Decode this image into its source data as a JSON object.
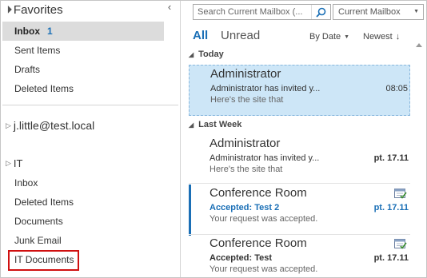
{
  "favorites": {
    "header": "Favorites",
    "items": [
      {
        "label": "Inbox",
        "count": "1"
      },
      {
        "label": "Sent Items"
      },
      {
        "label": "Drafts"
      },
      {
        "label": "Deleted Items"
      }
    ]
  },
  "accounts": [
    {
      "label": "j.little@test.local"
    }
  ],
  "it_group": {
    "header": "IT",
    "items": [
      {
        "label": "Inbox"
      },
      {
        "label": "Deleted Items"
      },
      {
        "label": "Documents"
      },
      {
        "label": "Junk Email"
      },
      {
        "label": "IT Documents"
      }
    ]
  },
  "search": {
    "placeholder": "Search Current Mailbox (...",
    "scope": "Current Mailbox"
  },
  "list_header": {
    "tab_all": "All",
    "tab_unread": "Unread",
    "sort_by": "By Date",
    "sort_order": "Newest"
  },
  "groups": [
    {
      "label": "Today",
      "messages": [
        {
          "sender": "Administrator",
          "subject": "Administrator has invited y...",
          "preview": "Here's the site that",
          "time": "08:05"
        }
      ]
    },
    {
      "label": "Last Week",
      "messages": [
        {
          "sender": "Administrator",
          "subject": "Administrator has invited y...",
          "preview": "Here's the site that",
          "time": "pt. 17.11"
        },
        {
          "sender": "Conference Room",
          "subject": "Accepted: Test 2",
          "preview": "Your request was accepted.",
          "time": "pt. 17.11"
        },
        {
          "sender": "Conference Room",
          "subject": "Accepted: Test",
          "preview": "Your request was accepted.",
          "time": "pt. 17.11"
        }
      ]
    }
  ],
  "colors": {
    "accent": "#1a6fb6",
    "selected_bg": "#cde6f7",
    "highlight_border": "#d01010"
  }
}
